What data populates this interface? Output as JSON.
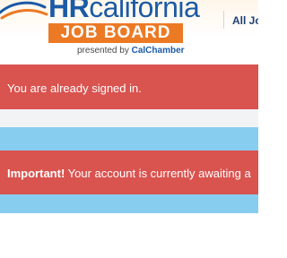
{
  "header": {
    "logo": {
      "hr": "HR",
      "california": "california",
      "job_board": "JOB BOARD",
      "presented_prefix": "presented by",
      "presented_brand": "CalChamber"
    },
    "nav": {
      "all_jobs_label": "All Jo"
    }
  },
  "alerts": {
    "signed_in": {
      "message": "You are already signed in."
    },
    "awaiting": {
      "strong": "Important!",
      "message": " Your account is currently awaiting a"
    }
  },
  "colors": {
    "danger": "#d9534f",
    "info_band": "#87cdf0",
    "brand_blue": "#1b5aa6",
    "brand_orange": "#ec7a25",
    "nav_text": "#1c3f79"
  },
  "icons": {
    "logo_swoosh": "swoosh-icon"
  }
}
